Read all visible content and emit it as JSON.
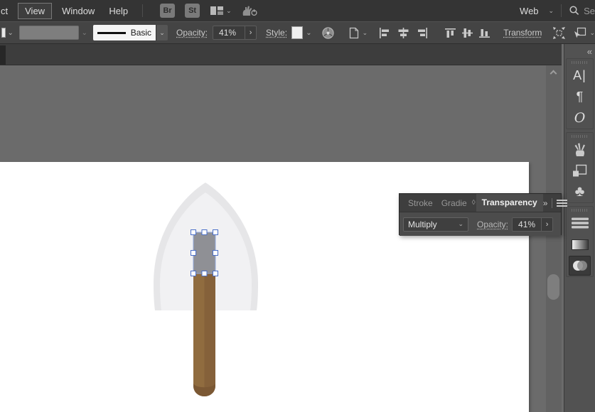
{
  "menubar": {
    "items": [
      {
        "label": "ct"
      },
      {
        "label": "View"
      },
      {
        "label": "Window"
      },
      {
        "label": "Help"
      }
    ],
    "badges": [
      "Br",
      "St"
    ],
    "workspace_label": "Web",
    "search_text": "Se"
  },
  "controlbar": {
    "brush_definition": "Basic",
    "opacity_label": "Opacity:",
    "opacity_value": "41%",
    "style_label": "Style:",
    "transform_label": "Transform"
  },
  "transparency_panel": {
    "tabs": [
      {
        "label": "Stroke",
        "active": false
      },
      {
        "label": "Gradie",
        "active": false
      },
      {
        "label": "Transparency",
        "active": true
      }
    ],
    "tab_divider_glyph": "◊",
    "expand_glyph": "»",
    "blend_mode": "Multiply",
    "opacity_label": "Opacity:",
    "opacity_value": "41%"
  },
  "dock": {
    "collapse_glyph": "«",
    "icons": [
      {
        "name": "character-panel",
        "glyph": "A|"
      },
      {
        "name": "paragraph-panel",
        "glyph": "¶"
      },
      {
        "name": "opentype-panel",
        "glyph": "O"
      },
      {
        "name": "brushes-panel"
      },
      {
        "name": "pathfinder-panel"
      },
      {
        "name": "symbols-panel",
        "glyph": "♣"
      },
      {
        "name": "stroke-panel"
      },
      {
        "name": "gradient-panel"
      },
      {
        "name": "transparency-panel",
        "active": true
      }
    ]
  },
  "canvas": {
    "artwork": {
      "description": "shovel illustration with selected ferrule rectangle",
      "blade_outer_color": "#e6e6e8",
      "blade_inner_color": "#f1f1f3",
      "ferrule_color": "#8f9095",
      "handle_left_color": "#906c3f",
      "handle_right_color": "#85613a",
      "handle_cap_color": "#7b5834",
      "selection_accent": "#4a6fc8",
      "bounding_box_color": "#93a9db",
      "artboard_color": "#ffffff",
      "pasteboard_color": "#6b6b6b"
    }
  }
}
